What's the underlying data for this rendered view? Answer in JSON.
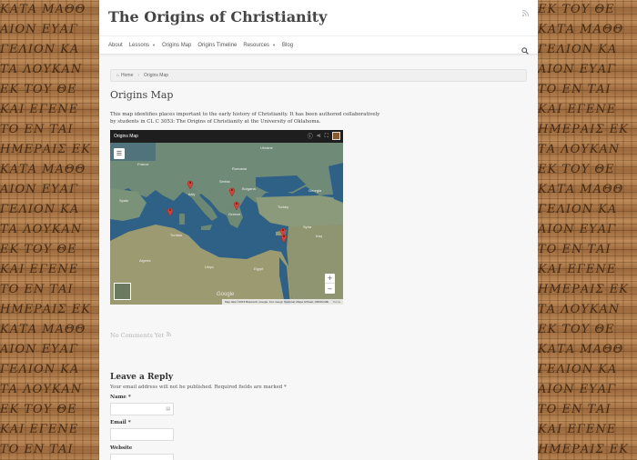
{
  "site": {
    "title": "The Origins of Christianity"
  },
  "nav": {
    "items": [
      {
        "label": "About",
        "has_caret": false
      },
      {
        "label": "Lessons",
        "has_caret": true
      },
      {
        "label": "Origins Map",
        "has_caret": false
      },
      {
        "label": "Origins Timeline",
        "has_caret": false
      },
      {
        "label": "Resources",
        "has_caret": true
      },
      {
        "label": "Blog",
        "has_caret": false
      }
    ],
    "search_icon": "search-icon"
  },
  "breadcrumb": {
    "home": "Home",
    "current": "Origins Map"
  },
  "page": {
    "title": "Origins Map",
    "intro": "This map identifies places important to the early history of Christianity. It has been authored collaboratively by students in CL C 3053: The Origins of Christianity at the University of Oklahoma."
  },
  "map": {
    "title": "Origins Map",
    "zoom_in": "+",
    "zoom_out": "−",
    "google": "Google",
    "attribution": "Map data ©2015 Basarsoft, Google, Inst. Geogr. Nacional, Mapa GISrael, ORION-ME",
    "terms": "Terms",
    "labels": {
      "france": "France",
      "spain": "Spain",
      "italy": "Italy",
      "romania": "Romania",
      "ukraine": "Ukraine",
      "turkey": "Turkey",
      "greece": "Greece",
      "georgia": "Georgia",
      "algeria": "Algeria",
      "libya": "Libya",
      "egypt": "Egypt",
      "syria": "Syria",
      "iraq": "Iraq",
      "tunisia": "Tunisia",
      "serbia": "Serbia",
      "bulgaria": "Bulgaria"
    }
  },
  "comments": {
    "text": "No Comments Yet"
  },
  "reply": {
    "title": "Leave a Reply",
    "note": "Your email address will not be published. Required fields are marked *",
    "name_label": "Name",
    "email_label": "Email",
    "website_label": "Website",
    "required_mark": "*"
  },
  "colors": {
    "sea": "#2e5f85",
    "land": "#6f8b78",
    "pin": "#d6433b",
    "page_bg": "#f7f7f7"
  }
}
